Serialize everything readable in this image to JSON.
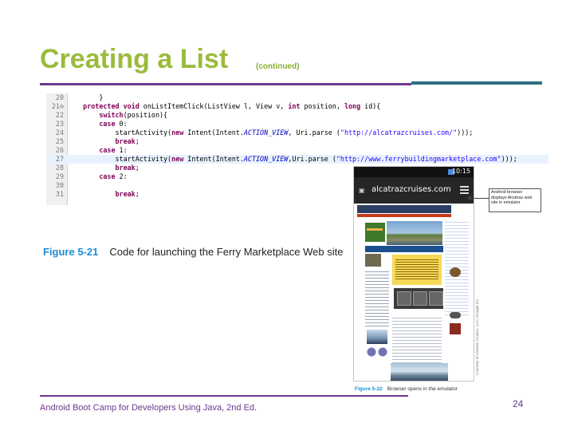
{
  "slide": {
    "title": "Creating a List",
    "subtitle": "(continued)",
    "footer": "Android Boot Camp for Developers Using Java, 2nd Ed.",
    "page_number": "24"
  },
  "colors": {
    "title": "#9bbb3c",
    "rule_purple": "#6b3a8f",
    "rule_teal": "#2f6f82",
    "caption_blue": "#1c8ed3"
  },
  "code": {
    "lines": [
      {
        "num": "20",
        "parts": [
          {
            "t": "        }",
            "c": "tx"
          }
        ]
      },
      {
        "num": "21⊖",
        "parts": [
          {
            "t": "    ",
            "c": "tx"
          },
          {
            "t": "protected void",
            "c": "kw"
          },
          {
            "t": " onListItemClick(ListView l, View v, ",
            "c": "tx"
          },
          {
            "t": "int",
            "c": "kw"
          },
          {
            "t": " position, ",
            "c": "tx"
          },
          {
            "t": "long",
            "c": "kw"
          },
          {
            "t": " id){",
            "c": "tx"
          }
        ]
      },
      {
        "num": "22",
        "parts": [
          {
            "t": "        ",
            "c": "tx"
          },
          {
            "t": "switch",
            "c": "kw"
          },
          {
            "t": "(position){",
            "c": "tx"
          }
        ]
      },
      {
        "num": "23",
        "parts": [
          {
            "t": "        ",
            "c": "tx"
          },
          {
            "t": "case",
            "c": "kw"
          },
          {
            "t": " 0:",
            "c": "tx"
          }
        ]
      },
      {
        "num": "24",
        "parts": [
          {
            "t": "            startActivity(",
            "c": "tx"
          },
          {
            "t": "new",
            "c": "kw"
          },
          {
            "t": " Intent(Intent.",
            "c": "tx"
          },
          {
            "t": "ACTION_VIEW",
            "c": "it"
          },
          {
            "t": ", Uri.parse (",
            "c": "tx"
          },
          {
            "t": "\"http://alcatrazcruises.com/\"",
            "c": "str"
          },
          {
            "t": ")));",
            "c": "tx"
          }
        ]
      },
      {
        "num": "25",
        "parts": [
          {
            "t": "            ",
            "c": "tx"
          },
          {
            "t": "break",
            "c": "kw"
          },
          {
            "t": ";",
            "c": "tx"
          }
        ]
      },
      {
        "num": "26",
        "parts": [
          {
            "t": "        ",
            "c": "tx"
          },
          {
            "t": "case",
            "c": "kw"
          },
          {
            "t": " 1:",
            "c": "tx"
          }
        ]
      },
      {
        "num": "27",
        "parts": [
          {
            "t": "            startActivity(",
            "c": "tx"
          },
          {
            "t": "new",
            "c": "kw"
          },
          {
            "t": " Intent(Intent.",
            "c": "tx"
          },
          {
            "t": "ACTION_VIEW",
            "c": "it"
          },
          {
            "t": ",Uri.parse (",
            "c": "tx"
          },
          {
            "t": "\"http://www.ferrybuildingmarketplace.com\"",
            "c": "str"
          },
          {
            "t": ")));",
            "c": "tx"
          }
        ]
      },
      {
        "num": "28",
        "parts": [
          {
            "t": "            ",
            "c": "tx"
          },
          {
            "t": "break",
            "c": "kw"
          },
          {
            "t": ";",
            "c": "tx"
          }
        ]
      },
      {
        "num": "29",
        "parts": [
          {
            "t": "        ",
            "c": "tx"
          },
          {
            "t": "case",
            "c": "kw"
          },
          {
            "t": " 2:",
            "c": "tx"
          }
        ]
      },
      {
        "num": "30",
        "parts": [
          {
            "t": "",
            "c": "tx"
          }
        ]
      },
      {
        "num": "31",
        "parts": [
          {
            "t": "            ",
            "c": "tx"
          },
          {
            "t": "break",
            "c": "kw"
          },
          {
            "t": ";",
            "c": "tx"
          }
        ]
      }
    ],
    "highlighted_line": 7
  },
  "figure_code": {
    "number": "Figure 5-21",
    "text": "Code for launching the Ferry Marketplace Web site"
  },
  "emulator": {
    "time": "10:15",
    "url": "alcatrazcruises.com",
    "url_icon": "page-icon",
    "menu_icon": "menu-icon"
  },
  "callout": {
    "text": "Android browser displays Alcatraz web site in emulator"
  },
  "credit": "Courtesy of Alcatraz Cruises, LLC | Google Inc.",
  "figure_emulator": {
    "number": "Figure 5-22",
    "text": "Browser opens in the emulator"
  }
}
